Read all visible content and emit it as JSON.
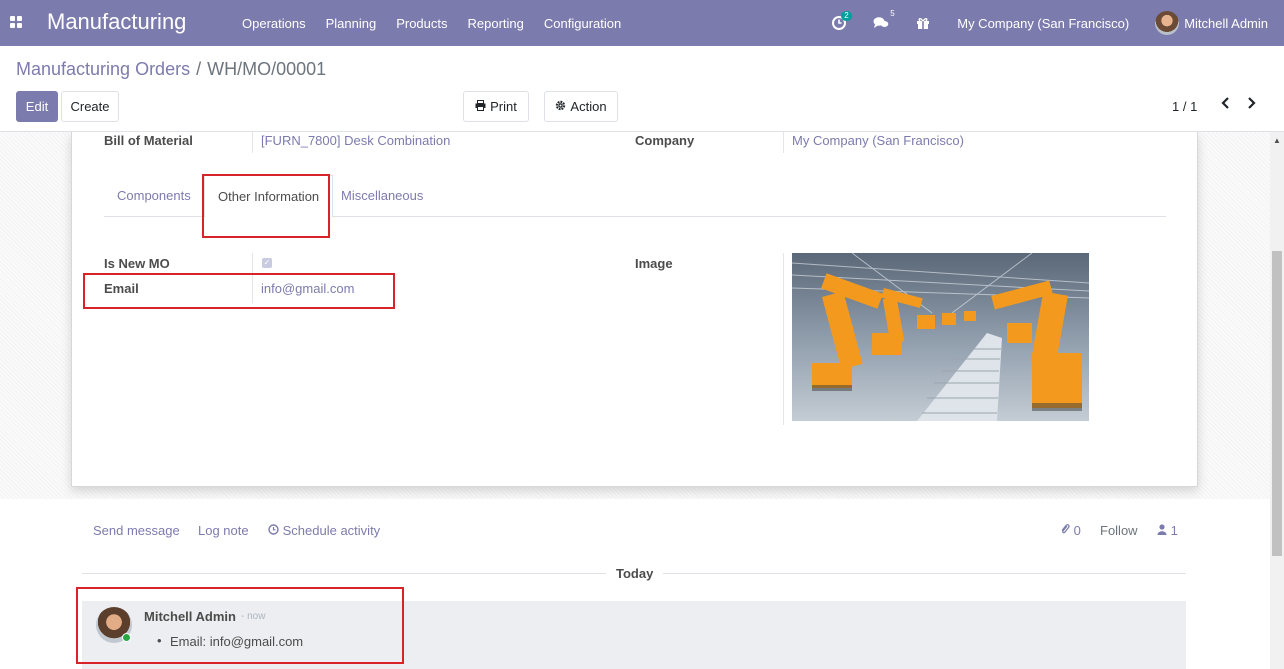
{
  "navbar": {
    "brand": "Manufacturing",
    "menu": [
      "Operations",
      "Planning",
      "Products",
      "Reporting",
      "Configuration"
    ],
    "activity_count": "2",
    "message_count": "5",
    "company": "My Company (San Francisco)",
    "user": "Mitchell Admin"
  },
  "breadcrumb": {
    "parent": "Manufacturing Orders",
    "separator": "/",
    "current": "WH/MO/00001"
  },
  "buttons": {
    "edit": "Edit",
    "create": "Create",
    "print": "Print",
    "action": "Action"
  },
  "pager": {
    "value": "1 / 1"
  },
  "form": {
    "bom_label": "Bill of Material",
    "bom_value": "[FURN_7800] Desk Combination",
    "company_label": "Company",
    "company_value": "My Company (San Francisco)",
    "tabs": [
      "Components",
      "Other Information",
      "Miscellaneous"
    ],
    "active_tab": "Other Information",
    "is_new_mo_label": "Is New MO",
    "is_new_mo_checked": true,
    "email_label": "Email",
    "email_value": "info@gmail.com",
    "image_label": "Image"
  },
  "chatter": {
    "send_message": "Send message",
    "log_note": "Log note",
    "schedule_activity": "Schedule activity",
    "attachments_count": "0",
    "follow": "Follow",
    "followers_count": "1",
    "today": "Today",
    "message": {
      "author": "Mitchell Admin",
      "time": "- now",
      "line": "Email: info@gmail.com"
    }
  },
  "colors": {
    "navbar": "#7c7bad",
    "link": "#7c7bad",
    "highlight": "#d8232a"
  },
  "icons": [
    "apps-icon",
    "clock-icon",
    "comments-icon",
    "gift-icon",
    "print-icon",
    "gear-icon",
    "chevron-left-icon",
    "chevron-right-icon",
    "clock-o-icon",
    "paperclip-icon",
    "user-icon",
    "checkbox-icon"
  ]
}
